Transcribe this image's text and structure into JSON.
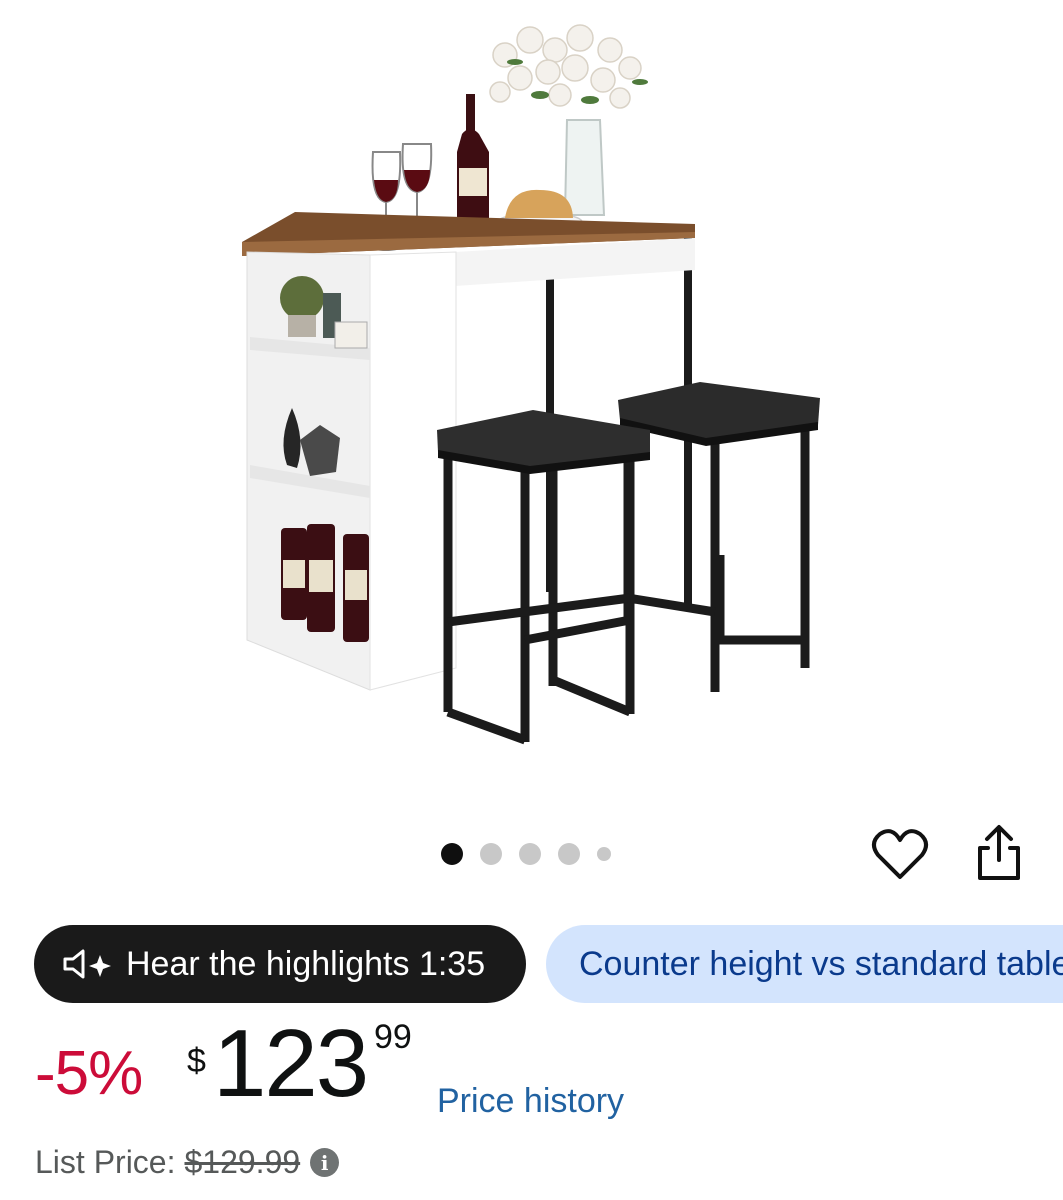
{
  "product": {
    "image_alt": "Bar table with storage shelves and two black bar stools",
    "gallery": {
      "total": 5,
      "active": 0
    }
  },
  "actions": {
    "wishlist_icon": "heart-outline-icon",
    "share_icon": "share-icon"
  },
  "chips": {
    "audio_label": "Hear the highlights 1:35",
    "question_label": "Counter height vs standard table"
  },
  "price": {
    "discount": "-5%",
    "currency": "$",
    "whole": "123",
    "fraction": "99",
    "history_link": "Price history",
    "list_price_label": "List Price:",
    "list_price": "$129.99"
  },
  "colors": {
    "discount": "#cc0c39",
    "link": "#2162a1",
    "chip_blue": "#d3e4fd"
  }
}
